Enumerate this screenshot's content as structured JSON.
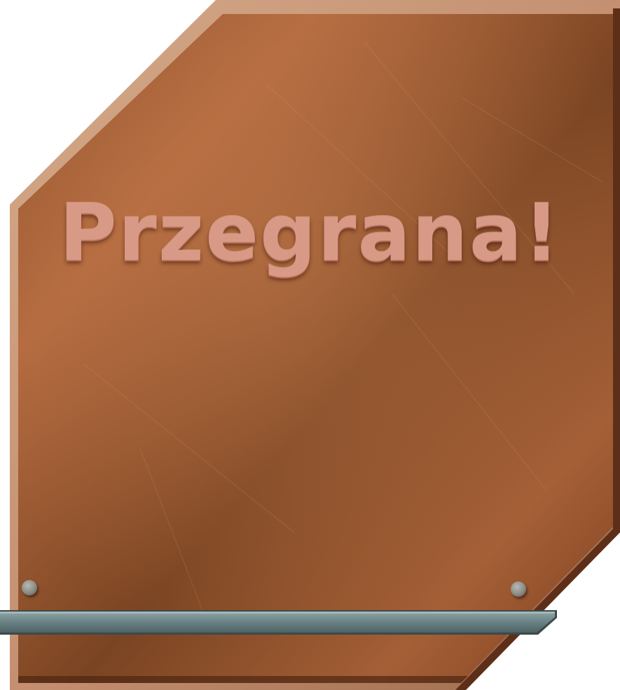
{
  "dialog": {
    "title": "Przegrana!"
  },
  "theme": {
    "panel_base": "#b36a3f",
    "panel_dark": "#6f3a1f",
    "panel_border": "#c99a78",
    "title_color": "#d89a86",
    "shelf_color": "#6f8689"
  }
}
